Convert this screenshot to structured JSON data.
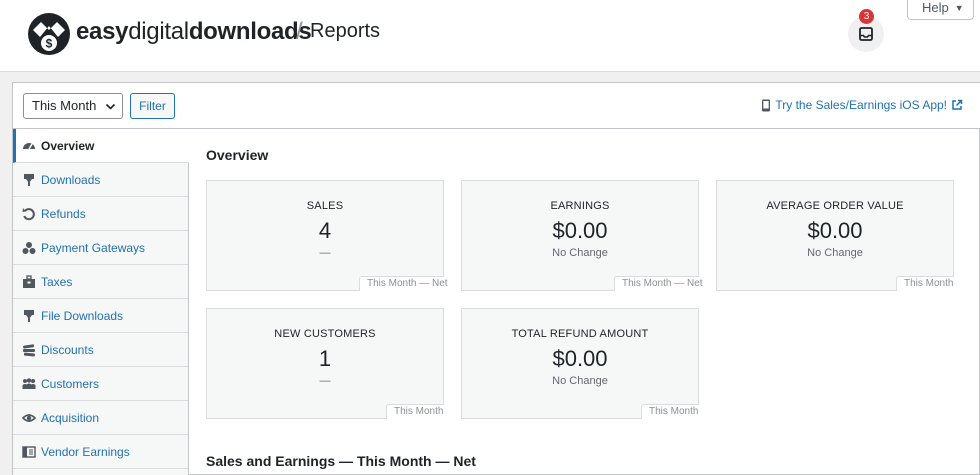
{
  "brand": {
    "name_bold_1": "easy",
    "name_light": "digital",
    "name_bold_2": "downloads",
    "separator": "/",
    "page": "Reports",
    "logo_symbol": "$"
  },
  "help": {
    "label": "Help",
    "caret": "▼"
  },
  "notifications": {
    "count": "3"
  },
  "filter": {
    "range_selected": "This Month",
    "button": "Filter",
    "ios_link": "Try the Sales/Earnings iOS App!"
  },
  "sidebar": {
    "items": [
      {
        "label": "Overview",
        "icon": "dashboard-icon",
        "active": true
      },
      {
        "label": "Downloads",
        "icon": "download-icon"
      },
      {
        "label": "Refunds",
        "icon": "refund-icon"
      },
      {
        "label": "Payment Gateways",
        "icon": "gateways-icon"
      },
      {
        "label": "Taxes",
        "icon": "taxes-icon"
      },
      {
        "label": "File Downloads",
        "icon": "file-download-icon"
      },
      {
        "label": "Discounts",
        "icon": "discounts-icon"
      },
      {
        "label": "Customers",
        "icon": "customers-icon"
      },
      {
        "label": "Acquisition",
        "icon": "acquisition-icon"
      },
      {
        "label": "Vendor Earnings",
        "icon": "vendor-earnings-icon"
      }
    ]
  },
  "overview": {
    "title": "Overview",
    "cards": [
      {
        "label": "SALES",
        "value": "4",
        "change": "—",
        "footer": "This Month — Net"
      },
      {
        "label": "EARNINGS",
        "value": "$0.00",
        "change": "No Change",
        "footer": "This Month — Net"
      },
      {
        "label": "AVERAGE ORDER VALUE",
        "value": "$0.00",
        "change": "No Change",
        "footer": "This Month"
      },
      {
        "label": "NEW CUSTOMERS",
        "value": "1",
        "change": "—",
        "footer": "This Month"
      },
      {
        "label": "TOTAL REFUND AMOUNT",
        "value": "$0.00",
        "change": "No Change",
        "footer": "This Month"
      }
    ]
  },
  "sales_section": {
    "title": "Sales and Earnings — This Month — Net"
  },
  "colors": {
    "accent": "#2271b1",
    "badge": "#d63638",
    "text": "#1d2327"
  }
}
